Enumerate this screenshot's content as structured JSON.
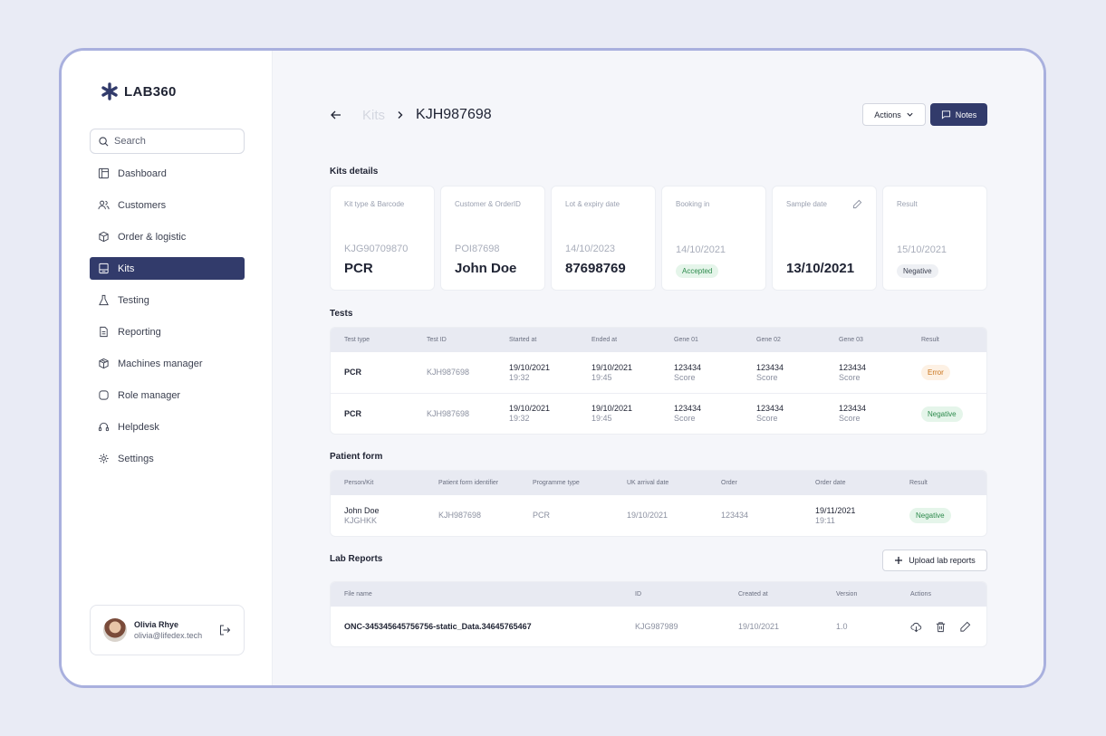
{
  "app": {
    "logo_text": "LAB360"
  },
  "sidebar": {
    "search_placeholder": "Search",
    "items": [
      {
        "label": "Dashboard",
        "icon": "dashboard-icon"
      },
      {
        "label": "Customers",
        "icon": "users-icon"
      },
      {
        "label": "Order & logistic",
        "icon": "box-icon"
      },
      {
        "label": "Kits",
        "icon": "kit-icon",
        "active": true
      },
      {
        "label": "Testing",
        "icon": "flask-icon"
      },
      {
        "label": "Reporting",
        "icon": "document-icon"
      },
      {
        "label": "Machines manager",
        "icon": "package-icon"
      },
      {
        "label": "Role manager",
        "icon": "role-icon"
      },
      {
        "label": "Helpdesk",
        "icon": "headset-icon"
      },
      {
        "label": "Settings",
        "icon": "gear-icon"
      }
    ],
    "user": {
      "name": "Olivia Rhye",
      "email": "olivia@lifedex.tech"
    }
  },
  "header": {
    "breadcrumb_parent": "Kits",
    "breadcrumb_current": "KJH987698",
    "actions_label": "Actions",
    "notes_label": "Notes"
  },
  "kit_details": {
    "title": "Kits details",
    "cards": [
      {
        "label": "Kit type & Barcode",
        "sub": "KJG90709870",
        "main": "PCR"
      },
      {
        "label": "Customer & OrderID",
        "sub": "POI87698",
        "main": "John Doe"
      },
      {
        "label": "Lot & expiry date",
        "sub": "14/10/2023",
        "main": "87698769"
      },
      {
        "label": "Booking in",
        "sub": "14/10/2021",
        "pill": "Accepted"
      },
      {
        "label": "Sample date",
        "sub": "",
        "main": "13/10/2021"
      },
      {
        "label": "Result",
        "sub": "15/10/2021",
        "pill": "Negative"
      }
    ]
  },
  "tests": {
    "title": "Tests",
    "columns": [
      "Test type",
      "Test ID",
      "Started at",
      "Ended at",
      "Gene 01",
      "Gene 02",
      "Gene 03",
      "Result"
    ],
    "rows": [
      {
        "type": "PCR",
        "id": "KJH987698",
        "start_date": "19/10/2021",
        "start_time": "19:32",
        "end_date": "19/10/2021",
        "end_time": "19:45",
        "g1": "123434",
        "g2": "123434",
        "g3": "123434",
        "score": "Score",
        "result": "Error"
      },
      {
        "type": "PCR",
        "id": "KJH987698",
        "start_date": "19/10/2021",
        "start_time": "19:32",
        "end_date": "19/10/2021",
        "end_time": "19:45",
        "g1": "123434",
        "g2": "123434",
        "g3": "123434",
        "score": "Score",
        "result": "Negative"
      }
    ]
  },
  "patient_form": {
    "title": "Patient form",
    "columns": [
      "Person/Kit",
      "Patient form identifier",
      "Programme type",
      "UK arrival date",
      "Order",
      "Order date",
      "Result"
    ],
    "row": {
      "person": "John Doe",
      "kit": "KJGHKK",
      "identifier": "KJH987698",
      "programme": "PCR",
      "arrival": "19/10/2021",
      "order": "123434",
      "order_date": "19/11/2021",
      "order_time": "19:11",
      "result": "Negative"
    }
  },
  "lab_reports": {
    "title": "Lab Reports",
    "upload_label": "Upload lab reports",
    "columns": [
      "File name",
      "ID",
      "Created at",
      "Version",
      "Actions"
    ],
    "row": {
      "file": "ONC-345345645756756-static_Data.34645765467",
      "id": "KJG987989",
      "created": "19/10/2021",
      "version": "1.0"
    }
  },
  "colors": {
    "primary": "#323b6b",
    "background": "#e9ebf5",
    "frame_border": "#a9b0de"
  }
}
